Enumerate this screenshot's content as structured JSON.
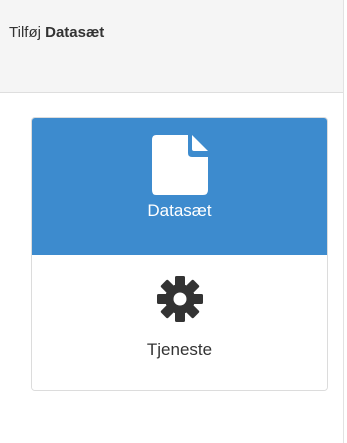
{
  "header": {
    "title_prefix": "Tilføj",
    "title_emphasis": "Datasæt"
  },
  "choices": [
    {
      "label": "Datasæt",
      "icon": "document-icon",
      "selected": true
    },
    {
      "label": "Tjeneste",
      "icon": "gear-icon",
      "selected": false
    }
  ],
  "colors": {
    "selected_background": "#3d8bce",
    "selected_text": "#ffffff",
    "icon_dark": "#333333",
    "header_background": "#f5f5f5"
  }
}
